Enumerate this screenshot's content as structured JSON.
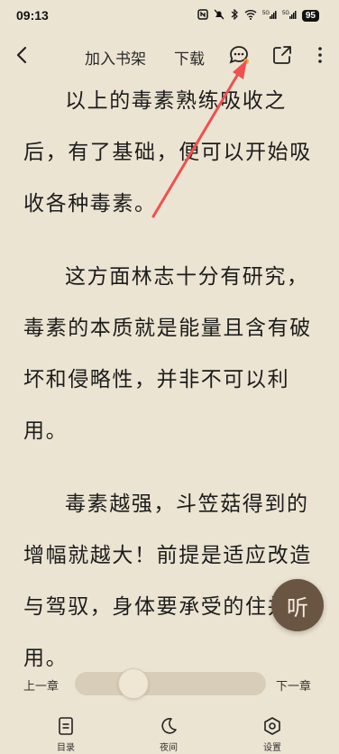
{
  "status_bar": {
    "time": "09:13",
    "battery": "95",
    "icons": [
      "nfc-icon",
      "mute-icon",
      "bluetooth-icon",
      "wifi-icon",
      "signal-5g-icon",
      "signal-5g-icon",
      "battery-icon"
    ]
  },
  "toolbar": {
    "add_to_shelf": "加入书架",
    "download": "下载",
    "icons": [
      "back-arrow-icon",
      "comment-icon",
      "share-icon",
      "more-icon"
    ]
  },
  "content": {
    "paragraphs": [
      "以上的毒素熟练吸收之后，有了基础，便可以开始吸收各种毒素。",
      "这方面林志十分有研究，毒素的本质就是能量且含有破坏和侵略性，并非不可以利用。",
      "毒素越强，斗笠菇得到的增幅就越大！前提是适应改造与驾驭，身体要承受的住并运用。"
    ]
  },
  "listen_button": {
    "label": "听"
  },
  "chapter_nav": {
    "prev": "上一章",
    "next": "下一章",
    "progress": 0.27
  },
  "bottom_nav": {
    "toc": "目录",
    "night": "夜间",
    "settings": "设置"
  },
  "colors": {
    "background": "#ece4d2",
    "text": "#1c1c1c",
    "listen_button": "#6a5543",
    "annotation_arrow": "#f0504f"
  }
}
